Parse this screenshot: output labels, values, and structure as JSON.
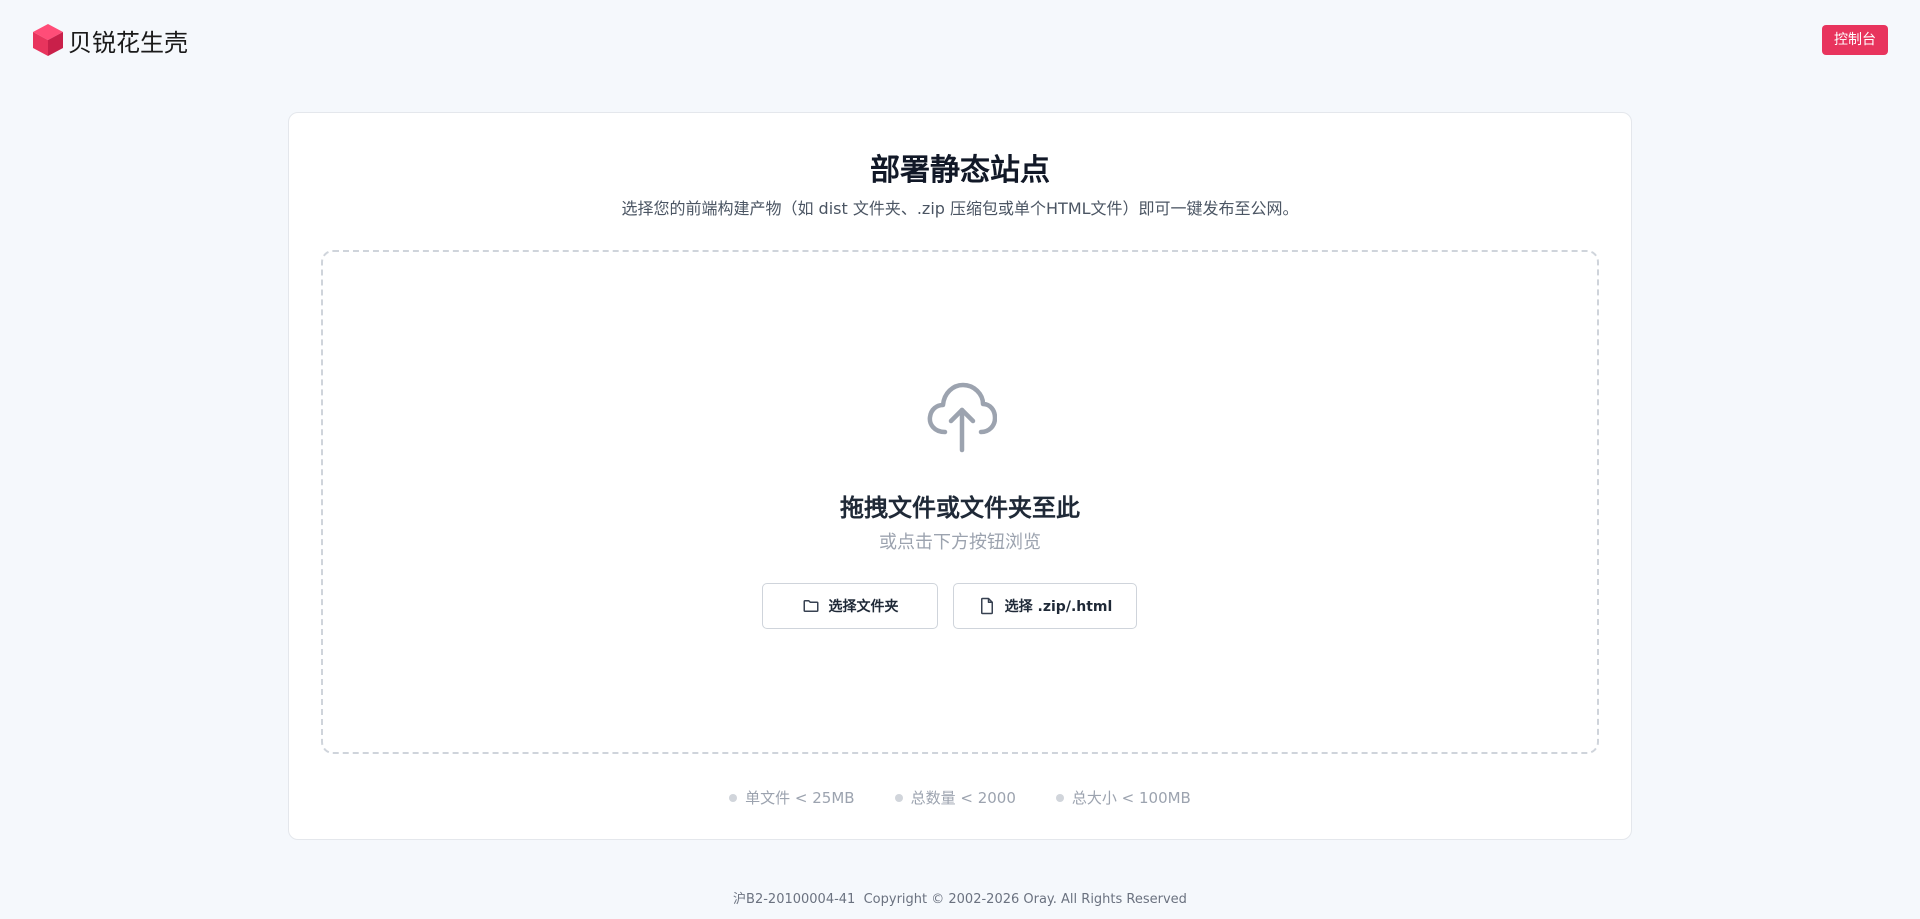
{
  "brand": {
    "name": "贝锐花生壳",
    "accent_color": "#e8345d",
    "logo_icon": "cube-logo-icon"
  },
  "header": {
    "console_label": "控制台"
  },
  "main": {
    "title": "部署静态站点",
    "subtitle": "选择您的前端构建产物（如 dist 文件夹、.zip 压缩包或单个HTML文件）即可一键发布至公网。",
    "dropzone": {
      "icon": "cloud-upload-icon",
      "title": "拖拽文件或文件夹至此",
      "hint": "或点击下方按钮浏览",
      "buttons": {
        "folder_label": "选择文件夹",
        "folder_icon": "folder-icon",
        "zip_label": "选择 .zip/.html",
        "zip_icon": "file-icon"
      }
    },
    "limits": [
      "单文件 < 25MB",
      "总数量 < 2000",
      "总大小 < 100MB"
    ]
  },
  "footer": {
    "icp": "沪B2-20100004-41",
    "copyright": "Copyright © 2002-2026 Oray. All Rights Reserved"
  }
}
